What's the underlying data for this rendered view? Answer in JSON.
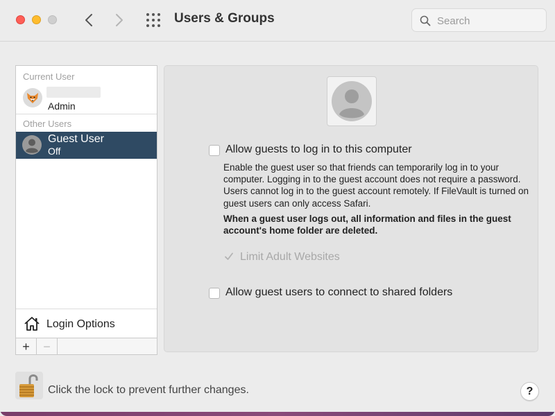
{
  "window": {
    "title": "Users & Groups"
  },
  "search": {
    "placeholder": "Search"
  },
  "sidebar": {
    "current_user_label": "Current User",
    "current_user": {
      "role": "Admin"
    },
    "other_users_label": "Other Users",
    "guest_user": {
      "name": "Guest User",
      "status": "Off"
    },
    "login_options_label": "Login Options",
    "add_label": "+",
    "remove_label": "−"
  },
  "main": {
    "allow_login_label": "Allow guests to log in to this computer",
    "allow_login_checked": false,
    "description": "Enable the guest user so that friends can temporarily log in to your computer. Logging in to the guest account does not require a password. Users cannot log in to the guest account remotely. If FileVault is turned on guest users can only access Safari.",
    "warning": "When a guest user logs out, all information and files in the guest account's home folder are deleted.",
    "limit_adult_label": "Limit Adult Websites",
    "limit_adult_checked": true,
    "shared_folders_label": "Allow guest users to connect to shared folders",
    "shared_folders_checked": false
  },
  "footer": {
    "lock_message": "Click the lock to prevent further changes.",
    "help_label": "?"
  },
  "colors": {
    "selection": "#2f4a63",
    "close": "#fe5f57",
    "minimize": "#febc2e"
  }
}
